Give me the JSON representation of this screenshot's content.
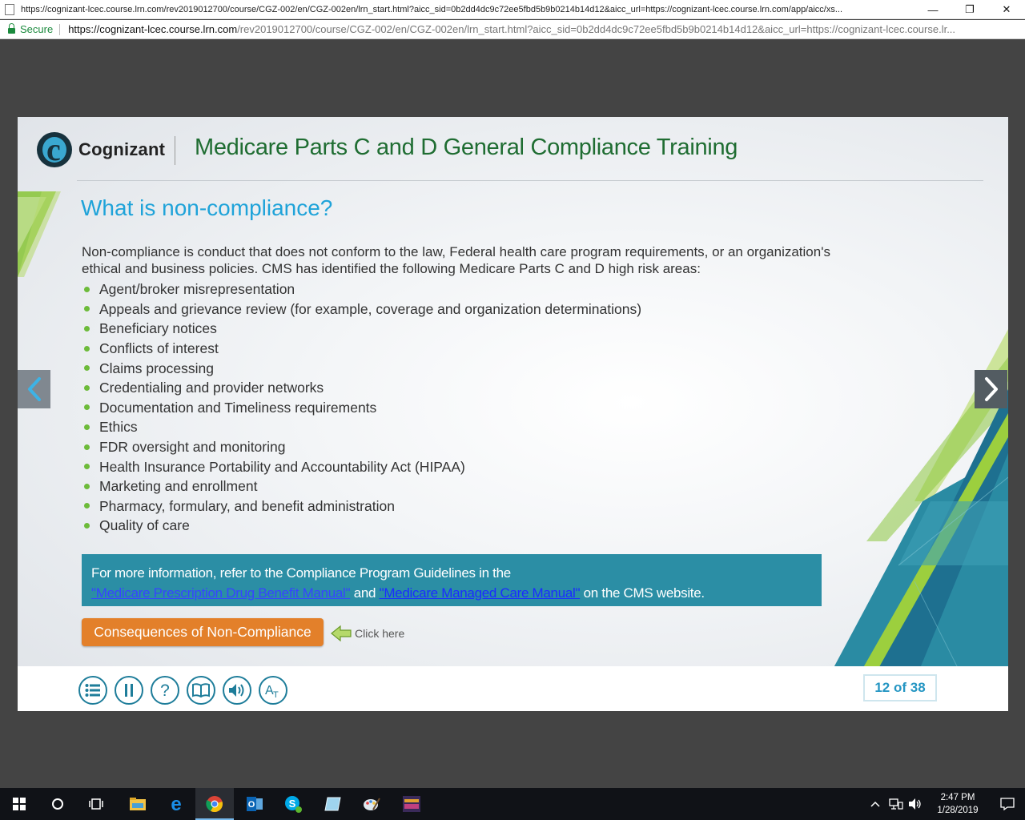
{
  "browser": {
    "tab_title": "https://cognizant-lcec.course.lrn.com/rev2019012700/course/CGZ-002/en/CGZ-002en/lrn_start.html?aicc_sid=0b2dd4dc9c72ee5fbd5b9b0214b14d12&aicc_url=https://cognizant-lcec.course.lrn.com/app/aicc/xs...",
    "secure_label": "Secure",
    "url_host": "https://cognizant-lcec.course.lrn.com",
    "url_path": "/rev2019012700/course/CGZ-002/en/CGZ-002en/lrn_start.html?aicc_sid=0b2dd4dc9c72ee5fbd5b9b0214b14d12&aicc_url=https://cognizant-lcec.course.lr...",
    "minimize": "—",
    "restore": "❐",
    "close": "✕"
  },
  "course": {
    "logo_text": "Cognizant",
    "title": "Medicare Parts C and D General Compliance Training"
  },
  "slide": {
    "heading": "What is non-compliance?",
    "intro": "Non-compliance is conduct that does not conform to the law, Federal health care program requirements, or an organization's ethical and business policies. CMS has identified the following Medicare Parts C and D high risk areas:",
    "bullets": [
      "Agent/broker misrepresentation",
      "Appeals and grievance review (for example, coverage and organization determinations)",
      "Beneficiary notices",
      "Conflicts of interest",
      "Claims processing",
      "Credentialing and provider networks",
      "Documentation and Timeliness requirements",
      "Ethics",
      "FDR oversight and monitoring",
      "Health Insurance Portability and Accountability Act (HIPAA)",
      "Marketing and enrollment",
      "Pharmacy, formulary, and benefit administration",
      "Quality of care"
    ],
    "info": {
      "line1": "For more information, refer to the Compliance Program Guidelines in the",
      "link1": "\"Medicare Prescription Drug Benefit Manual\"",
      "and": " and ",
      "link2": "\"Medicare Managed Care Manual\"",
      "suffix": " on the CMS website."
    },
    "consequences_button": "Consequences of Non-Compliance",
    "click_hint": "Click here"
  },
  "player": {
    "page_counter": "12 of 38",
    "tools": [
      "menu-icon",
      "pause-icon",
      "help-icon",
      "glossary-book-icon",
      "audio-icon",
      "text-size-icon"
    ]
  },
  "taskbar": {
    "time": "2:47 PM",
    "date": "1/28/2019"
  },
  "colors": {
    "heading": "#1fa3d9",
    "title_green": "#1f6d32",
    "info_box": "#2b8ea5",
    "button_orange": "#e3802a",
    "bullet_green": "#6dbb3a",
    "teal_accent": "#1e7d9a"
  }
}
